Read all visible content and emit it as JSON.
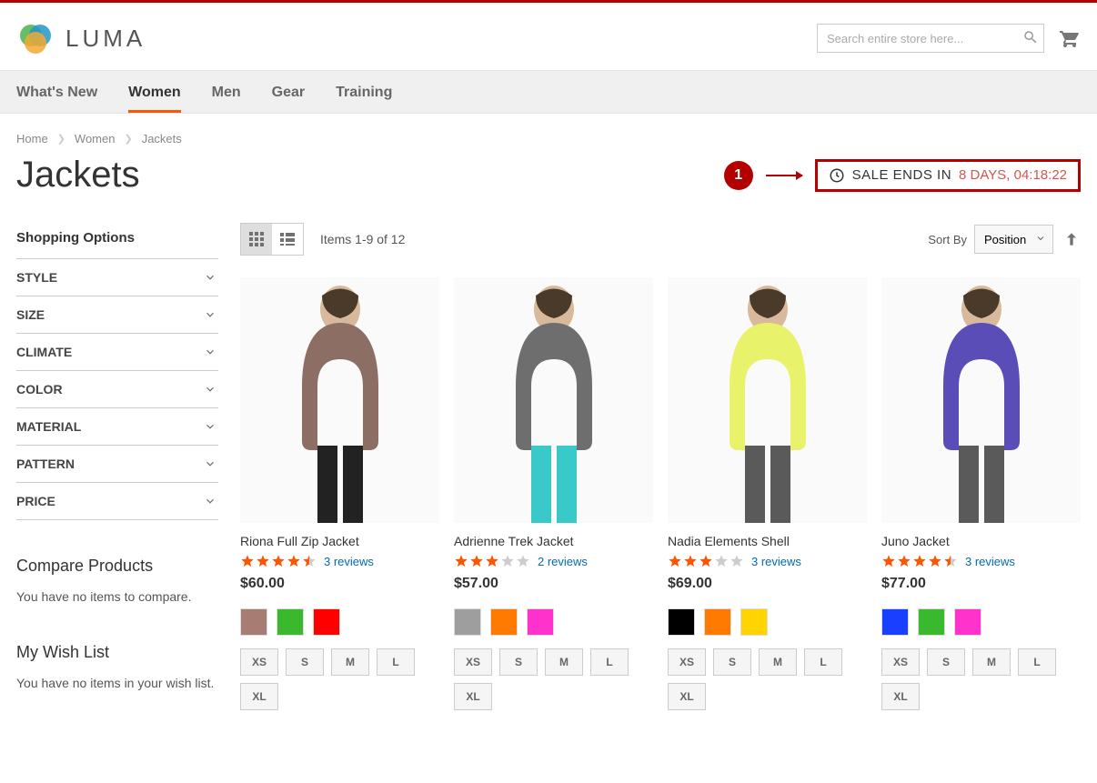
{
  "brand": "LUMA",
  "search": {
    "placeholder": "Search entire store here..."
  },
  "nav": {
    "items": [
      {
        "label": "What's New"
      },
      {
        "label": "Women"
      },
      {
        "label": "Men"
      },
      {
        "label": "Gear"
      },
      {
        "label": "Training"
      }
    ],
    "active_index": 1
  },
  "breadcrumbs": {
    "home": "Home",
    "women": "Women",
    "current": "Jackets"
  },
  "page_title": "Jackets",
  "callout_number": "1",
  "sale": {
    "label": "SALE ENDS IN",
    "time": "8 DAYS, 04:18:22"
  },
  "sidebar": {
    "title": "Shopping Options",
    "filters": [
      {
        "label": "STYLE"
      },
      {
        "label": "SIZE"
      },
      {
        "label": "CLIMATE"
      },
      {
        "label": "COLOR"
      },
      {
        "label": "MATERIAL"
      },
      {
        "label": "PATTERN"
      },
      {
        "label": "PRICE"
      }
    ],
    "compare": {
      "title": "Compare Products",
      "text": "You have no items to compare."
    },
    "wishlist": {
      "title": "My Wish List",
      "text": "You have no items in your wish list."
    }
  },
  "toolbar": {
    "count": "Items 1-9 of 12",
    "sort_label": "Sort By",
    "sort_value": "Position"
  },
  "products": [
    {
      "name": "Riona Full Zip Jacket",
      "stars": 4.5,
      "reviews": "3 reviews",
      "price": "$60.00",
      "colors": [
        "#a67c73",
        "#3ab92e",
        "#ff0000"
      ],
      "sizes": [
        "XS",
        "S",
        "M",
        "L",
        "XL"
      ],
      "img": {
        "body": "#8c6e65",
        "pants": "#222"
      }
    },
    {
      "name": "Adrienne Trek Jacket",
      "stars": 3,
      "reviews": "2 reviews",
      "price": "$57.00",
      "colors": [
        "#9e9e9e",
        "#ff7a00",
        "#ff33cc"
      ],
      "sizes": [
        "XS",
        "S",
        "M",
        "L",
        "XL"
      ],
      "img": {
        "body": "#6e6e6e",
        "pants": "#39c9c9"
      }
    },
    {
      "name": "Nadia Elements Shell",
      "stars": 3,
      "reviews": "3 reviews",
      "price": "$69.00",
      "colors": [
        "#000000",
        "#ff7a00",
        "#ffd400"
      ],
      "sizes": [
        "XS",
        "S",
        "M",
        "L",
        "XL"
      ],
      "img": {
        "body": "#e8f26a",
        "pants": "#5a5a5a"
      }
    },
    {
      "name": "Juno Jacket",
      "stars": 4.5,
      "reviews": "3 reviews",
      "price": "$77.00",
      "colors": [
        "#1a3fff",
        "#3ab92e",
        "#ff33cc"
      ],
      "sizes": [
        "XS",
        "S",
        "M",
        "L",
        "XL"
      ],
      "img": {
        "body": "#5b4db8",
        "pants": "#5a5a5a"
      }
    }
  ]
}
